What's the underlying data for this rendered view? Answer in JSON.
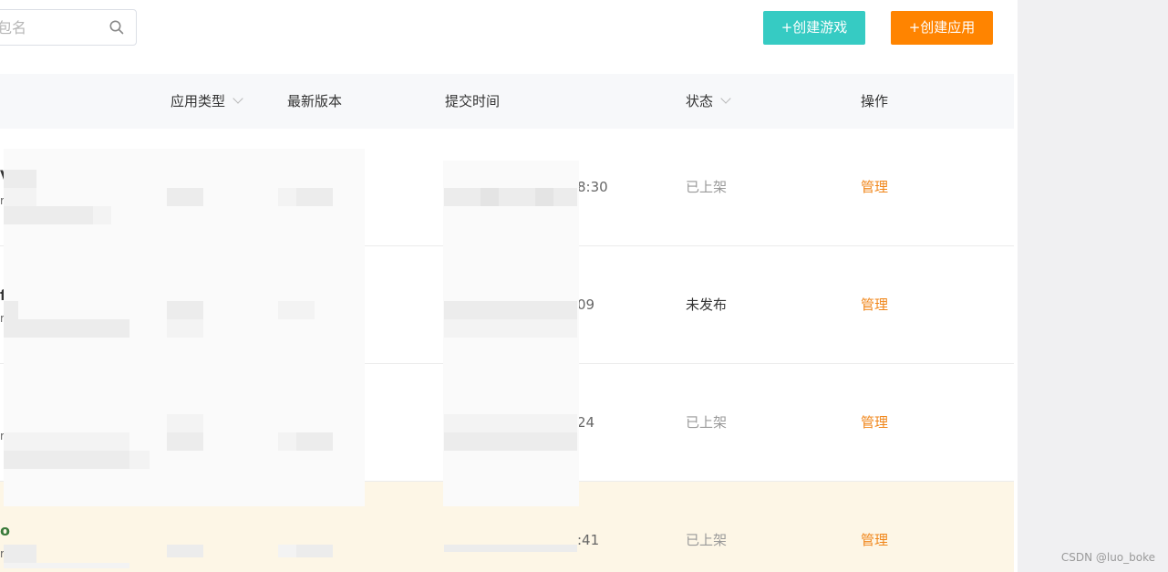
{
  "search": {
    "placeholder": "包名"
  },
  "buttons": {
    "create_game": "+创建游戏",
    "create_app": "+创建应用"
  },
  "table": {
    "headers": {
      "app_type": "应用类型",
      "latest_version": "最新版本",
      "submit_time": "提交时间",
      "status": "状态",
      "action": "操作"
    },
    "rows": [
      {
        "name_fragment": "V",
        "sub_fragment": "r",
        "time_fragment": "8:30",
        "status": "已上架",
        "action": "管理"
      },
      {
        "name_fragment": "f",
        "sub_fragment": "r",
        "time_fragment": "09",
        "status": "未发布",
        "action": "管理"
      },
      {
        "name_fragment": "",
        "sub_fragment": "r",
        "time_fragment": "24",
        "status": "已上架",
        "action": "管理"
      },
      {
        "name_fragment": "o",
        "sub_fragment": "r",
        "time_fragment": ":41",
        "status": "已上架",
        "action": "管理"
      }
    ]
  },
  "watermark": "CSDN @luo_boke",
  "colors": {
    "create_game_bg": "#36cbc3",
    "create_app_bg": "#ff8400",
    "manage_link": "#f0861a",
    "highlight_row": "#fdf6e6"
  }
}
